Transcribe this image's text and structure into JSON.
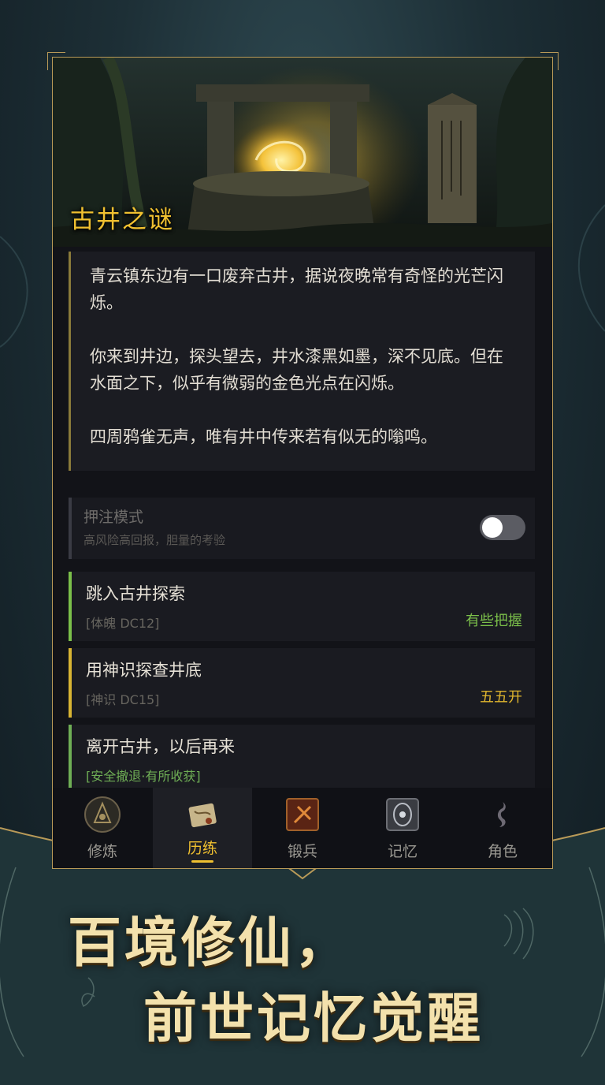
{
  "scene": {
    "title": "古井之谜",
    "narrative": [
      "青云镇东边有一口废弃古井，据说夜晚常有奇怪的光芒闪烁。",
      "你来到井边，探头望去，井水漆黑如墨，深不见底。但在水面之下，似乎有微弱的金色光点在闪烁。",
      "四周鸦雀无声，唯有井中传来若有似无的嗡鸣。"
    ]
  },
  "bet_mode": {
    "title": "押注模式",
    "subtitle": "高风险高回报，胆量的考验",
    "enabled": false
  },
  "choices": [
    {
      "title": "跳入古井探索",
      "tag": "[体魄 DC12]",
      "odds": "有些把握",
      "odds_color": "#7bbf4a",
      "accent": "#7bbf4a"
    },
    {
      "title": "用神识探查井底",
      "tag": "[神识 DC15]",
      "odds": "五五开",
      "odds_color": "#e0b62e",
      "accent": "#d8b433"
    },
    {
      "title": "离开古井，以后再来",
      "tag": "[安全撤退·有所收获]",
      "odds": "",
      "odds_color": "#6fae55",
      "accent": "#6fae55"
    }
  ],
  "tabs": [
    {
      "label": "修炼",
      "icon": "cultivation-icon",
      "active": false
    },
    {
      "label": "历练",
      "icon": "scroll-map-icon",
      "active": true
    },
    {
      "label": "锻兵",
      "icon": "forge-icon",
      "active": false
    },
    {
      "label": "记忆",
      "icon": "memory-icon",
      "active": false
    },
    {
      "label": "角色",
      "icon": "character-icon",
      "active": false
    }
  ],
  "promo": {
    "line1": "百境修仙，",
    "line2": "前世记忆觉醒"
  },
  "colors": {
    "accent_gold": "#f0c030",
    "frame_gold": "#b99a58",
    "panel_bg": "#1a1b21"
  }
}
